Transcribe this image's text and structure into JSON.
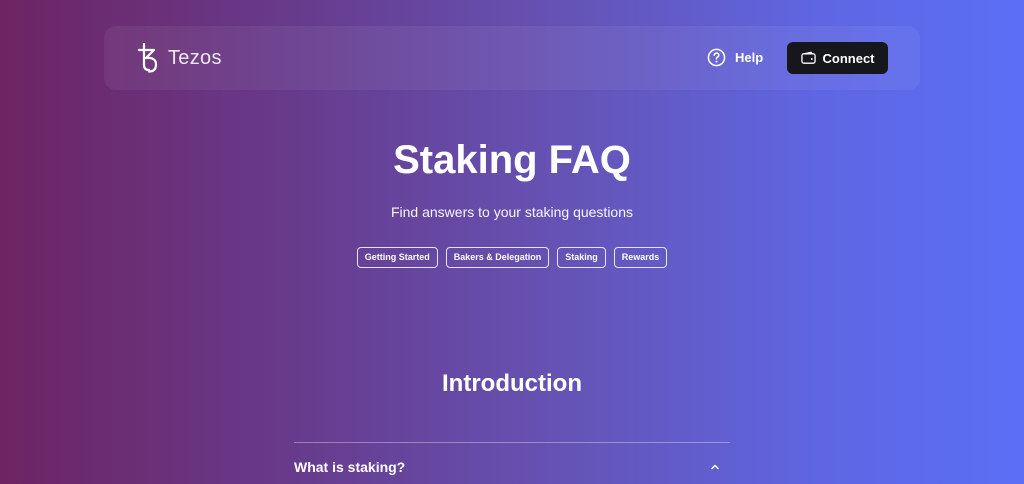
{
  "header": {
    "brand_name": "Tezos",
    "help_label": "Help",
    "connect_label": "Connect",
    "icons": {
      "logo": "tezos-logo",
      "help": "question-circle-icon",
      "connect": "wallet-icon"
    }
  },
  "hero": {
    "title": "Staking FAQ",
    "subtitle": "Find answers to your staking questions",
    "categories": [
      "Getting Started",
      "Bakers & Delegation",
      "Staking",
      "Rewards"
    ]
  },
  "section": {
    "title": "Introduction"
  },
  "faq": {
    "items": [
      {
        "question": "What is staking?",
        "expanded": true,
        "icon": "chevron-up-icon"
      }
    ]
  },
  "colors": {
    "gradient_start": "#6d2463",
    "gradient_end": "#5b6ff6",
    "connect_button": "#16161d"
  }
}
